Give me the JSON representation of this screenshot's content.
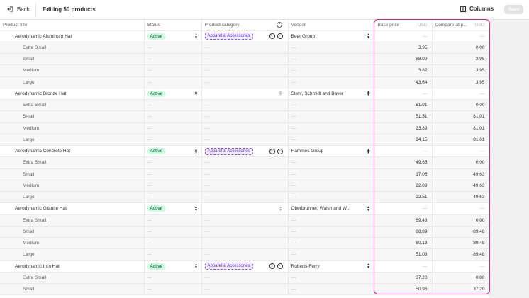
{
  "topbar": {
    "back_label": "Back",
    "title": "Editing 50 products",
    "columns_label": "Columns",
    "save_label": "Save"
  },
  "columns": {
    "product_title": "Product title",
    "status": "Status",
    "product_category": "Product category",
    "vendor": "Vendor",
    "base_price": "Base price",
    "base_price_unit": "USD",
    "compare_at": "Compare-at p...",
    "compare_at_unit": "USD"
  },
  "placeholder": "—",
  "products": [
    {
      "title": "Aerodynamic Aluminum Hat",
      "status": "Active",
      "category": "Apparel & Accessories",
      "vendor": "Beer Group",
      "variants": [
        {
          "title": "Extra Small",
          "base": "3.95",
          "compare": "0.00"
        },
        {
          "title": "Small",
          "base": "88.09",
          "compare": "3.95"
        },
        {
          "title": "Medium",
          "base": "3.82",
          "compare": "3.95"
        },
        {
          "title": "Large",
          "base": "43.64",
          "compare": "3.95"
        }
      ]
    },
    {
      "title": "Aerodynamic Bronze Hat",
      "status": "Active",
      "category": "",
      "vendor": "Stehr, Schmidt and Bayer",
      "variants": [
        {
          "title": "Extra Small",
          "base": "81.01",
          "compare": "0.00"
        },
        {
          "title": "Small",
          "base": "51.51",
          "compare": "81.01"
        },
        {
          "title": "Medium",
          "base": "23.89",
          "compare": "81.01"
        },
        {
          "title": "Large",
          "base": "94.15",
          "compare": "81.01"
        }
      ]
    },
    {
      "title": "Aerodynamic Concrete Hat",
      "status": "Active",
      "category": "Apparel & Accessories",
      "vendor": "Hammes Group",
      "variants": [
        {
          "title": "Extra Small",
          "base": "49.63",
          "compare": "0.00"
        },
        {
          "title": "Small",
          "base": "17.06",
          "compare": "49.63"
        },
        {
          "title": "Medium",
          "base": "22.09",
          "compare": "49.63"
        },
        {
          "title": "Large",
          "base": "22.51",
          "compare": "49.63"
        }
      ]
    },
    {
      "title": "Aerodynamic Granite Hat",
      "status": "Active",
      "category": "",
      "vendor": "Oberbrunner, Walsh and W...",
      "variants": [
        {
          "title": "Extra Small",
          "base": "89.48",
          "compare": "0.00"
        },
        {
          "title": "Small",
          "base": "88.89",
          "compare": "89.48"
        },
        {
          "title": "Medium",
          "base": "80.13",
          "compare": "89.48"
        },
        {
          "title": "Large",
          "base": "51.08",
          "compare": "89.48"
        }
      ]
    },
    {
      "title": "Aerodynamic Iron Hat",
      "status": "Active",
      "category": "Apparel & Accessories",
      "vendor": "Roberts-Ferry",
      "variants": [
        {
          "title": "Extra Small",
          "base": "37.20",
          "compare": "0.00"
        },
        {
          "title": "Small",
          "base": "50.96",
          "compare": "37.20"
        }
      ]
    }
  ],
  "colors": {
    "highlight": "#e0218a",
    "active_bg": "#cdfee1",
    "category_border": "#8051ff"
  }
}
